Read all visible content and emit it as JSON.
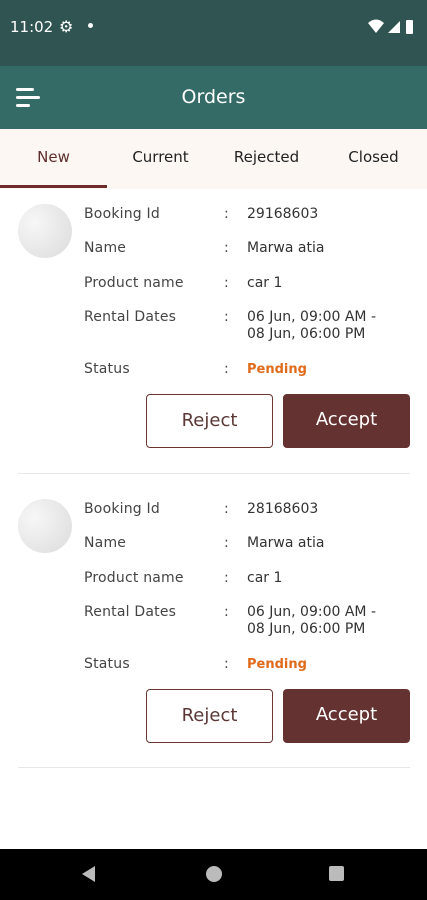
{
  "status_bar": {
    "time": "11:02"
  },
  "app_bar": {
    "title": "Orders"
  },
  "tabs": [
    {
      "label": "New"
    },
    {
      "label": "Current"
    },
    {
      "label": "Rejected"
    },
    {
      "label": "Closed"
    }
  ],
  "field_labels": {
    "booking_id": "Booking Id",
    "name": "Name",
    "product_name": "Product name",
    "rental_dates": "Rental Dates",
    "status": "Status",
    "separator": ":"
  },
  "orders": [
    {
      "booking_id": "29168603",
      "name": "Marwa atia",
      "product_name": "car 1",
      "rental_dates_line1": "06 Jun, 09:00 AM -",
      "rental_dates_line2": "08 Jun, 06:00 PM",
      "status": "Pending",
      "reject_label": "Reject",
      "accept_label": "Accept"
    },
    {
      "booking_id": "28168603",
      "name": "Marwa atia",
      "product_name": "car 1",
      "rental_dates_line1": "06 Jun, 09:00 AM -",
      "rental_dates_line2": "08 Jun, 06:00 PM",
      "status": "Pending",
      "reject_label": "Reject",
      "accept_label": "Accept"
    }
  ],
  "colors": {
    "status_bar": "#2f5451",
    "app_bar": "#356b66",
    "accent": "#643331",
    "pending": "#e06b1b"
  }
}
